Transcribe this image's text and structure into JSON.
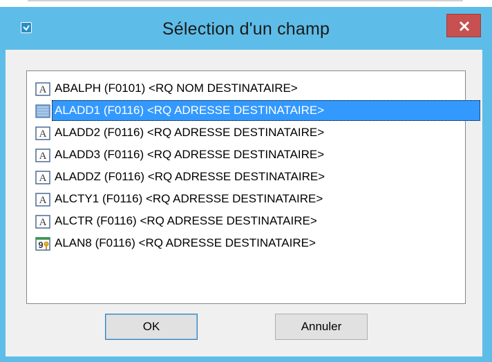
{
  "window": {
    "title": "Sélection d'un champ"
  },
  "list": {
    "items": [
      {
        "label": "ABALPH (F0101) <RQ NOM DESTINATAIRE>",
        "icon": "text-field-icon",
        "selected": false
      },
      {
        "label": "ALADD1 (F0116) <RQ ADRESSE DESTINATAIRE>",
        "icon": "text-field-icon",
        "selected": true
      },
      {
        "label": "ALADD2 (F0116) <RQ ADRESSE DESTINATAIRE>",
        "icon": "text-field-icon",
        "selected": false
      },
      {
        "label": "ALADD3 (F0116) <RQ ADRESSE DESTINATAIRE>",
        "icon": "text-field-icon",
        "selected": false
      },
      {
        "label": "ALADDZ (F0116) <RQ ADRESSE DESTINATAIRE>",
        "icon": "text-field-icon",
        "selected": false
      },
      {
        "label": "ALCTY1 (F0116) <RQ ADRESSE DESTINATAIRE>",
        "icon": "text-field-icon",
        "selected": false
      },
      {
        "label": "ALCTR (F0116) <RQ ADRESSE DESTINATAIRE>",
        "icon": "text-field-icon",
        "selected": false
      },
      {
        "label": "ALAN8 (F0116) <RQ ADRESSE DESTINATAIRE>",
        "icon": "numeric-key-field-icon",
        "selected": false
      }
    ]
  },
  "buttons": {
    "ok_label": "OK",
    "cancel_label": "Annuler"
  },
  "colors": {
    "titlebar": "#5ebde8",
    "close": "#c75050",
    "selection": "#3399ff"
  }
}
